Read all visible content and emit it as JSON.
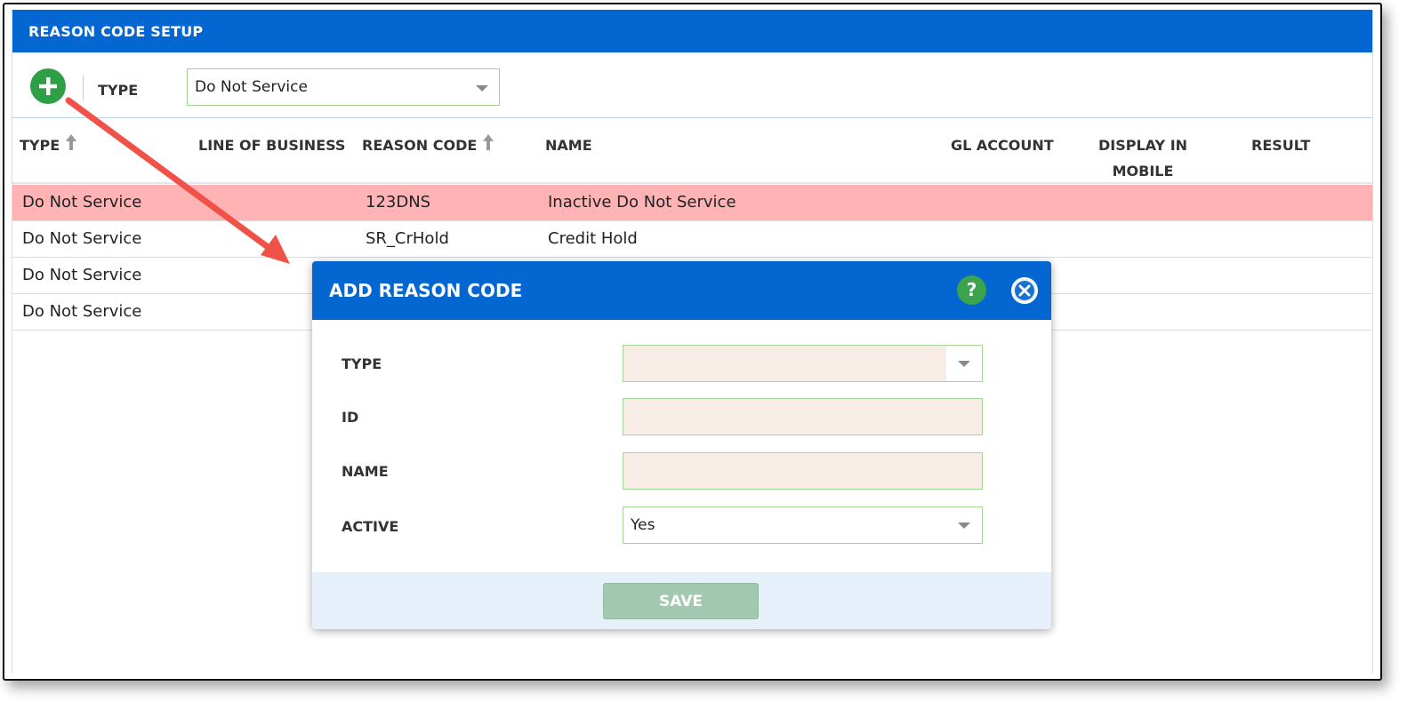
{
  "page": {
    "title": "REASON CODE SETUP"
  },
  "toolbar": {
    "add_icon": "plus-circle-icon",
    "type_label": "TYPE",
    "type_value": "Do Not Service"
  },
  "table": {
    "columns": [
      "TYPE",
      "LINE OF BUSINESS",
      "REASON CODE",
      "NAME",
      "GL ACCOUNT",
      "DISPLAY IN MOBILE",
      "RESULT"
    ],
    "display_in_mobile_line1": "DISPLAY IN",
    "display_in_mobile_line2": "MOBILE",
    "rows": [
      {
        "type": "Do Not Service",
        "line_of_business": "",
        "reason_code": "123DNS",
        "name": "Inactive Do Not Service",
        "highlighted": true
      },
      {
        "type": "Do Not Service",
        "line_of_business": "",
        "reason_code": "SR_CrHold",
        "name": "Credit Hold",
        "highlighted": false
      },
      {
        "type": "Do Not Service",
        "line_of_business": "",
        "reason_code": "",
        "name": "",
        "highlighted": false
      },
      {
        "type": "Do Not Service",
        "line_of_business": "",
        "reason_code": "",
        "name": "",
        "highlighted": false
      }
    ],
    "highlight_color": "#ffb3b5"
  },
  "modal": {
    "title": "ADD REASON CODE",
    "help_label": "?",
    "fields": {
      "type_label": "TYPE",
      "type_value": "",
      "id_label": "ID",
      "id_value": "",
      "name_label": "NAME",
      "name_value": "",
      "active_label": "ACTIVE",
      "active_value": "Yes"
    },
    "save_label": "SAVE"
  },
  "colors": {
    "header_blue": "#0466d0",
    "add_green": "#2e9e47",
    "annotation_arrow": "#f0524a",
    "required_field": "#f8ece7"
  }
}
